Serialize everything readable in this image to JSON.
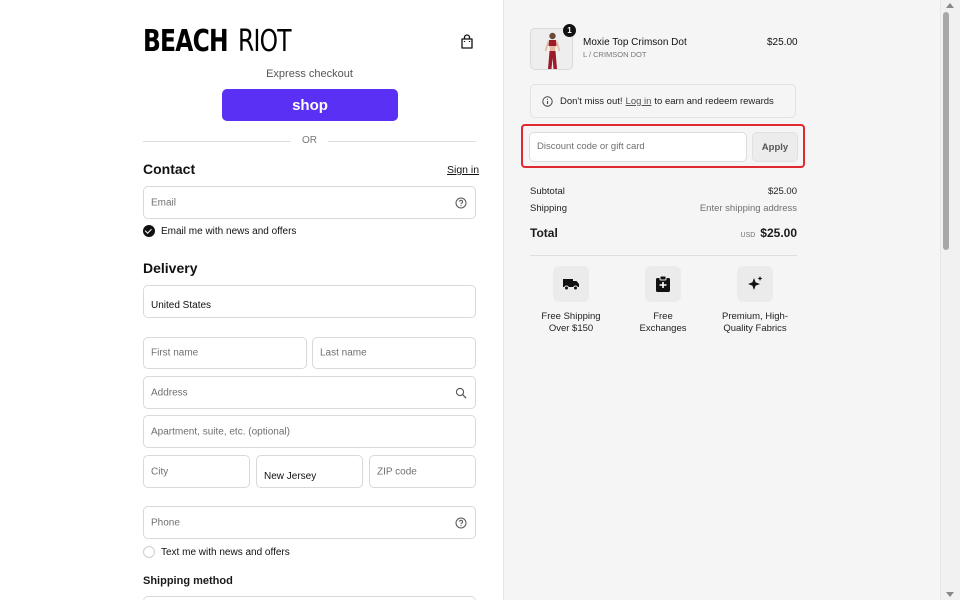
{
  "brand": {
    "logo_part1": "BEACH",
    "logo_part2": "RIOT"
  },
  "express": {
    "label": "Express checkout",
    "shop_button": "shop",
    "or_text": "OR"
  },
  "contact": {
    "heading": "Contact",
    "sign_in": "Sign in",
    "email_placeholder": "Email",
    "newsletter_label": "Email me with news and offers",
    "newsletter_checked": true
  },
  "delivery": {
    "heading": "Delivery",
    "country_value": "United States",
    "first_name_placeholder": "First name",
    "last_name_placeholder": "Last name",
    "address_placeholder": "Address",
    "apartment_placeholder": "Apartment, suite, etc. (optional)",
    "city_placeholder": "City",
    "state_value": "New Jersey",
    "zip_placeholder": "ZIP code",
    "phone_placeholder": "Phone",
    "sms_label": "Text me with news and offers",
    "sms_checked": false
  },
  "shipping_method": {
    "heading": "Shipping method"
  },
  "order": {
    "item": {
      "quantity": "1",
      "name": "Moxie Top Crimson Dot",
      "variant": "L / CRIMSON DOT",
      "price": "$25.00"
    },
    "notice": {
      "prefix": "Don't miss out!",
      "link": "Log in",
      "suffix": "to earn and redeem rewards"
    },
    "discount": {
      "placeholder": "Discount code or gift card",
      "apply_label": "Apply"
    },
    "summary": {
      "subtotal_label": "Subtotal",
      "subtotal_value": "$25.00",
      "shipping_label": "Shipping",
      "shipping_value": "Enter shipping address",
      "total_label": "Total",
      "currency": "USD",
      "total_value": "$25.00"
    },
    "features": [
      {
        "icon": "truck-icon",
        "label_line1": "Free Shipping",
        "label_line2": "Over $150"
      },
      {
        "icon": "exchange-icon",
        "label_line1": "Free",
        "label_line2": "Exchanges"
      },
      {
        "icon": "sparkle-icon",
        "label_line1": "Premium, High-",
        "label_line2": "Quality Fabrics"
      }
    ]
  },
  "colors": {
    "shop_purple": "#5a31f4",
    "highlight_red": "#e0282e",
    "panel_bg": "#f5f5f5"
  }
}
